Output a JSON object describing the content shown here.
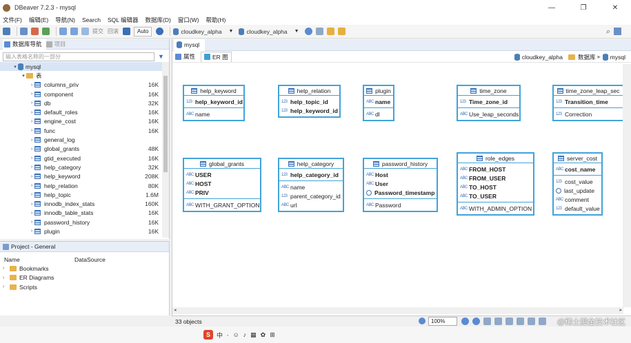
{
  "window": {
    "title": "DBeaver 7.2.3 - mysql",
    "minimize": "—",
    "maximize": "❐",
    "close": "✕"
  },
  "menu": [
    "文件(F)",
    "编辑(E)",
    "导航(N)",
    "Search",
    "SQL 编辑器",
    "数据库(D)",
    "窗口(W)",
    "帮助(H)"
  ],
  "toolbar": {
    "commit_label": "提交",
    "rollback_label": "回滚",
    "tx_mode": "Auto",
    "connection_1": "cloudkey_alpha",
    "connection_2": "cloudkey_alpha"
  },
  "navigator": {
    "tab_label": "数据库导航",
    "tab2_label": "项目",
    "filter_placeholder": "输入表格名称的一部分",
    "root": "mysql",
    "folder": "表",
    "tables": [
      {
        "name": "columns_priv",
        "size": "16K"
      },
      {
        "name": "component",
        "size": "16K"
      },
      {
        "name": "db",
        "size": "32K"
      },
      {
        "name": "default_roles",
        "size": "16K"
      },
      {
        "name": "engine_cost",
        "size": "16K"
      },
      {
        "name": "func",
        "size": "16K"
      },
      {
        "name": "general_log",
        "size": ""
      },
      {
        "name": "global_grants",
        "size": "48K"
      },
      {
        "name": "gtid_executed",
        "size": "16K"
      },
      {
        "name": "help_category",
        "size": "32K"
      },
      {
        "name": "help_keyword",
        "size": "208K"
      },
      {
        "name": "help_relation",
        "size": "80K"
      },
      {
        "name": "help_topic",
        "size": "1.6M"
      },
      {
        "name": "innodb_index_stats",
        "size": "160K"
      },
      {
        "name": "innodb_table_stats",
        "size": "16K"
      },
      {
        "name": "password_history",
        "size": "16K"
      },
      {
        "name": "plugin",
        "size": "16K"
      }
    ]
  },
  "project": {
    "tab_label": "Project - General",
    "col_name": "Name",
    "col_source": "DataSource",
    "items": [
      "Bookmarks",
      "ER Diagrams",
      "Scripts"
    ]
  },
  "editor": {
    "tab_label": "mysql",
    "sub_props": "属性",
    "sub_er": "ER 图",
    "crumb_conn": "cloudkey_alpha",
    "crumb_db": "数据库",
    "crumb_schema": "mysql"
  },
  "entities": {
    "help_keyword": {
      "title": "help_keyword",
      "keys": [
        "help_keyword_id"
      ],
      "attrs": [
        "name"
      ]
    },
    "help_relation": {
      "title": "help_relation",
      "keys": [
        "help_topic_id",
        "help_keyword_id"
      ],
      "attrs": []
    },
    "plugin": {
      "title": "plugin",
      "keys": [
        "name"
      ],
      "attrs": [
        "dl"
      ]
    },
    "time_zone": {
      "title": "time_zone",
      "keys": [
        "Time_zone_id"
      ],
      "attrs": [
        "Use_leap_seconds"
      ]
    },
    "time_zone_leap": {
      "title": "time_zone_leap_sec",
      "keys": [
        "Transition_time"
      ],
      "attrs": [
        "Correction"
      ]
    },
    "global_grants": {
      "title": "global_grants",
      "keys": [
        "USER",
        "HOST",
        "PRIV"
      ],
      "attrs": [
        "WITH_GRANT_OPTION"
      ]
    },
    "help_category": {
      "title": "help_category",
      "keys": [
        "help_category_id"
      ],
      "attrs": [
        "name",
        "parent_category_id",
        "url"
      ]
    },
    "password_history": {
      "title": "password_history",
      "keys": [
        "Host",
        "User",
        "Password_timestamp"
      ],
      "attrs": [
        "Password"
      ]
    },
    "role_edges": {
      "title": "role_edges",
      "keys": [
        "FROM_HOST",
        "FROM_USER",
        "TO_HOST",
        "TO_USER"
      ],
      "attrs": [
        "WITH_ADMIN_OPTION"
      ]
    },
    "server_cost": {
      "title": "server_cost",
      "keys": [
        "cost_name"
      ],
      "attrs": [
        "cost_value",
        "last_update",
        "comment",
        "default_value"
      ]
    }
  },
  "status": {
    "objects": "33 objects",
    "zoom": "100%"
  },
  "watermark": "@稀土掘金技术社区"
}
